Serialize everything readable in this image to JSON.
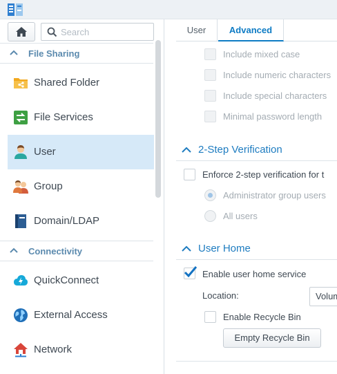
{
  "sidebar": {
    "search": {
      "placeholder": "Search"
    },
    "sections": [
      {
        "label": "File Sharing"
      },
      {
        "label": "Connectivity"
      }
    ],
    "items": [
      {
        "label": "Shared Folder",
        "icon": "shared-folder-icon"
      },
      {
        "label": "File Services",
        "icon": "file-services-icon"
      },
      {
        "label": "User",
        "icon": "user-icon",
        "selected": true
      },
      {
        "label": "Group",
        "icon": "group-icon"
      },
      {
        "label": "Domain/LDAP",
        "icon": "domain-ldap-icon"
      },
      {
        "label": "QuickConnect",
        "icon": "quickconnect-icon"
      },
      {
        "label": "External Access",
        "icon": "external-access-icon"
      },
      {
        "label": "Network",
        "icon": "network-icon"
      }
    ]
  },
  "main": {
    "tabs": [
      {
        "label": "User"
      },
      {
        "label": "Advanced",
        "active": true
      }
    ],
    "password_options": [
      {
        "label": "Include mixed case",
        "checked": false
      },
      {
        "label": "Include numeric characters",
        "checked": false
      },
      {
        "label": "Include special characters",
        "checked": false
      },
      {
        "label": "Minimal password length",
        "checked": false
      }
    ],
    "two_step": {
      "title": "2-Step Verification",
      "enforce_label": "Enforce 2-step verification for t",
      "enforce_checked": false,
      "radios": [
        {
          "label": "Administrator group users",
          "checked": true
        },
        {
          "label": "All users",
          "checked": false
        }
      ]
    },
    "user_home": {
      "title": "User Home",
      "enable_label": "Enable user home service",
      "enable_checked": true,
      "location_label": "Location:",
      "location_value": "Volum",
      "recycle_label": "Enable Recycle Bin",
      "recycle_checked": false,
      "empty_button": "Empty Recycle Bin"
    }
  },
  "colors": {
    "accent": "#0d7bc4",
    "section_header": "#1e7cc0",
    "sidebar_section": "#5b8aae",
    "selected_bg": "#d6e9f8"
  }
}
